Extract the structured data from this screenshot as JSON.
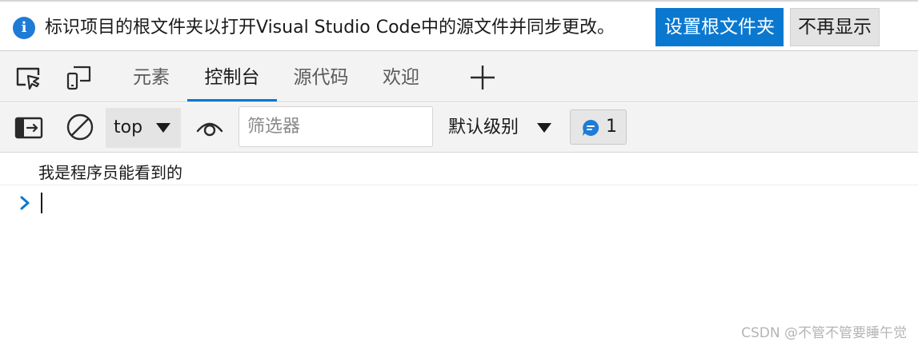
{
  "infobar": {
    "icon": "info-icon",
    "icon_glyph": "i",
    "message": "标识项目的根文件夹以打开Visual Studio Code中的源文件并同步更改。",
    "primary_button": "设置根文件夹",
    "secondary_button": "不再显示"
  },
  "tabs": {
    "inspect_icon": "inspect-element-icon",
    "device_icon": "device-emulation-icon",
    "items": [
      {
        "label": "元素",
        "active": false
      },
      {
        "label": "控制台",
        "active": true
      },
      {
        "label": "源代码",
        "active": false
      },
      {
        "label": "欢迎",
        "active": false
      }
    ],
    "add_icon": "plus-icon"
  },
  "toolbar": {
    "sidebar_icon": "show-sidebar-icon",
    "clear_icon": "clear-console-icon",
    "context": "top",
    "eye_icon": "live-expression-eye-icon",
    "filter_placeholder": "筛选器",
    "filter_value": "",
    "level": "默认级别",
    "issues_icon": "message-bubble-icon",
    "issues_count": "1"
  },
  "console": {
    "logs": [
      "我是程序员能看到的"
    ],
    "prompt_icon": "chevron-right-icon"
  },
  "colors": {
    "accent": "#0b78d0",
    "info_icon": "#1e7cd6",
    "toolbar_bg": "#f3f3f3"
  },
  "watermark": "CSDN @不管不管要睡午觉"
}
